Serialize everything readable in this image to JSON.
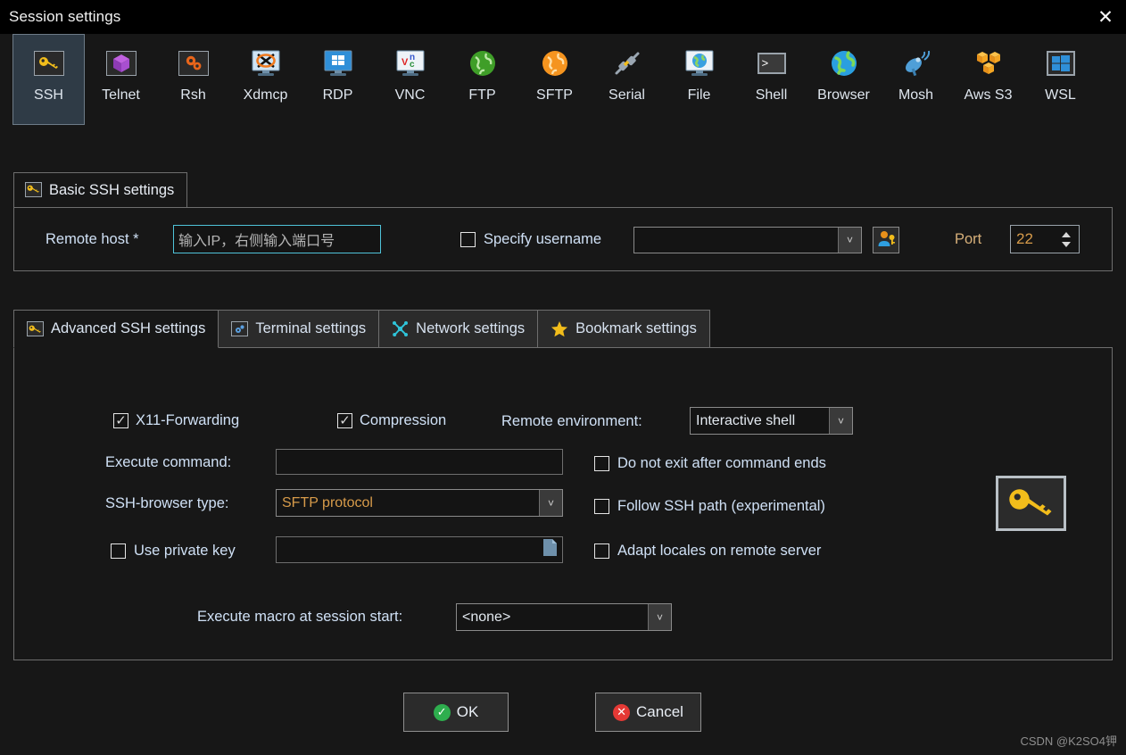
{
  "window": {
    "title": "Session settings",
    "close_label": "✕"
  },
  "protocols": [
    {
      "label": "SSH",
      "icon": "key-icon",
      "selected": true
    },
    {
      "label": "Telnet",
      "icon": "cube-icon",
      "selected": false
    },
    {
      "label": "Rsh",
      "icon": "gears-icon",
      "selected": false
    },
    {
      "label": "Xdmcp",
      "icon": "xmonitor-icon",
      "selected": false
    },
    {
      "label": "RDP",
      "icon": "windows-monitor-icon",
      "selected": false
    },
    {
      "label": "VNC",
      "icon": "vnc-monitor-icon",
      "selected": false
    },
    {
      "label": "FTP",
      "icon": "green-globe-icon",
      "selected": false
    },
    {
      "label": "SFTP",
      "icon": "orange-globe-icon",
      "selected": false
    },
    {
      "label": "Serial",
      "icon": "plug-icon",
      "selected": false
    },
    {
      "label": "File",
      "icon": "globe-monitor-icon",
      "selected": false
    },
    {
      "label": "Shell",
      "icon": "terminal-icon",
      "selected": false
    },
    {
      "label": "Browser",
      "icon": "blue-globe-icon",
      "selected": false
    },
    {
      "label": "Mosh",
      "icon": "satellite-icon",
      "selected": false
    },
    {
      "label": "Aws S3",
      "icon": "aws-cubes-icon",
      "selected": false
    },
    {
      "label": "WSL",
      "icon": "windows-icon",
      "selected": false
    }
  ],
  "basic": {
    "legend": "Basic SSH settings",
    "legend_icon": "key-icon",
    "remote_host_label": "Remote host *",
    "remote_host_value": "",
    "remote_host_placeholder": "输入IP，右侧输入端口号",
    "specify_username_label": "Specify username",
    "specify_username_checked": false,
    "username_value": "",
    "username_picker_icon": "user-key-icon",
    "port_label": "Port",
    "port_value": "22"
  },
  "tabs": [
    {
      "label": "Advanced SSH settings",
      "icon": "key-icon",
      "active": true
    },
    {
      "label": "Terminal settings",
      "icon": "terminal-settings-icon",
      "active": false
    },
    {
      "label": "Network settings",
      "icon": "network-icon",
      "active": false
    },
    {
      "label": "Bookmark settings",
      "icon": "star-icon",
      "active": false
    }
  ],
  "advanced": {
    "x11_label": "X11-Forwarding",
    "x11_checked": true,
    "compression_label": "Compression",
    "compression_checked": true,
    "remote_env_label": "Remote environment:",
    "remote_env_value": "Interactive shell",
    "execute_command_label": "Execute command:",
    "execute_command_value": "",
    "ssh_browser_label": "SSH-browser type:",
    "ssh_browser_value": "SFTP protocol",
    "use_private_key_label": "Use private key",
    "use_private_key_checked": false,
    "private_key_value": "",
    "private_key_browse_icon": "file-icon",
    "do_not_exit_label": "Do not exit after command ends",
    "do_not_exit_checked": false,
    "follow_ssh_label": "Follow SSH path (experimental)",
    "follow_ssh_checked": false,
    "adapt_locales_label": "Adapt locales on remote server",
    "adapt_locales_checked": false,
    "macro_label": "Execute macro at session start:",
    "macro_value": "<none>",
    "side_icon": "key-icon"
  },
  "buttons": {
    "ok_label": "OK",
    "cancel_label": "Cancel"
  },
  "watermark": "CSDN @K2SO4钾",
  "colors": {
    "window_bg": "#171717",
    "titlebar_bg": "#000000",
    "selected_tab_bg": "#2f3b46",
    "accent_orange": "#f2a716",
    "focus_border": "#4fc3d9",
    "label_blue": "#cfe0f5",
    "ok_green": "#2eae4e",
    "cancel_red": "#e53935"
  }
}
